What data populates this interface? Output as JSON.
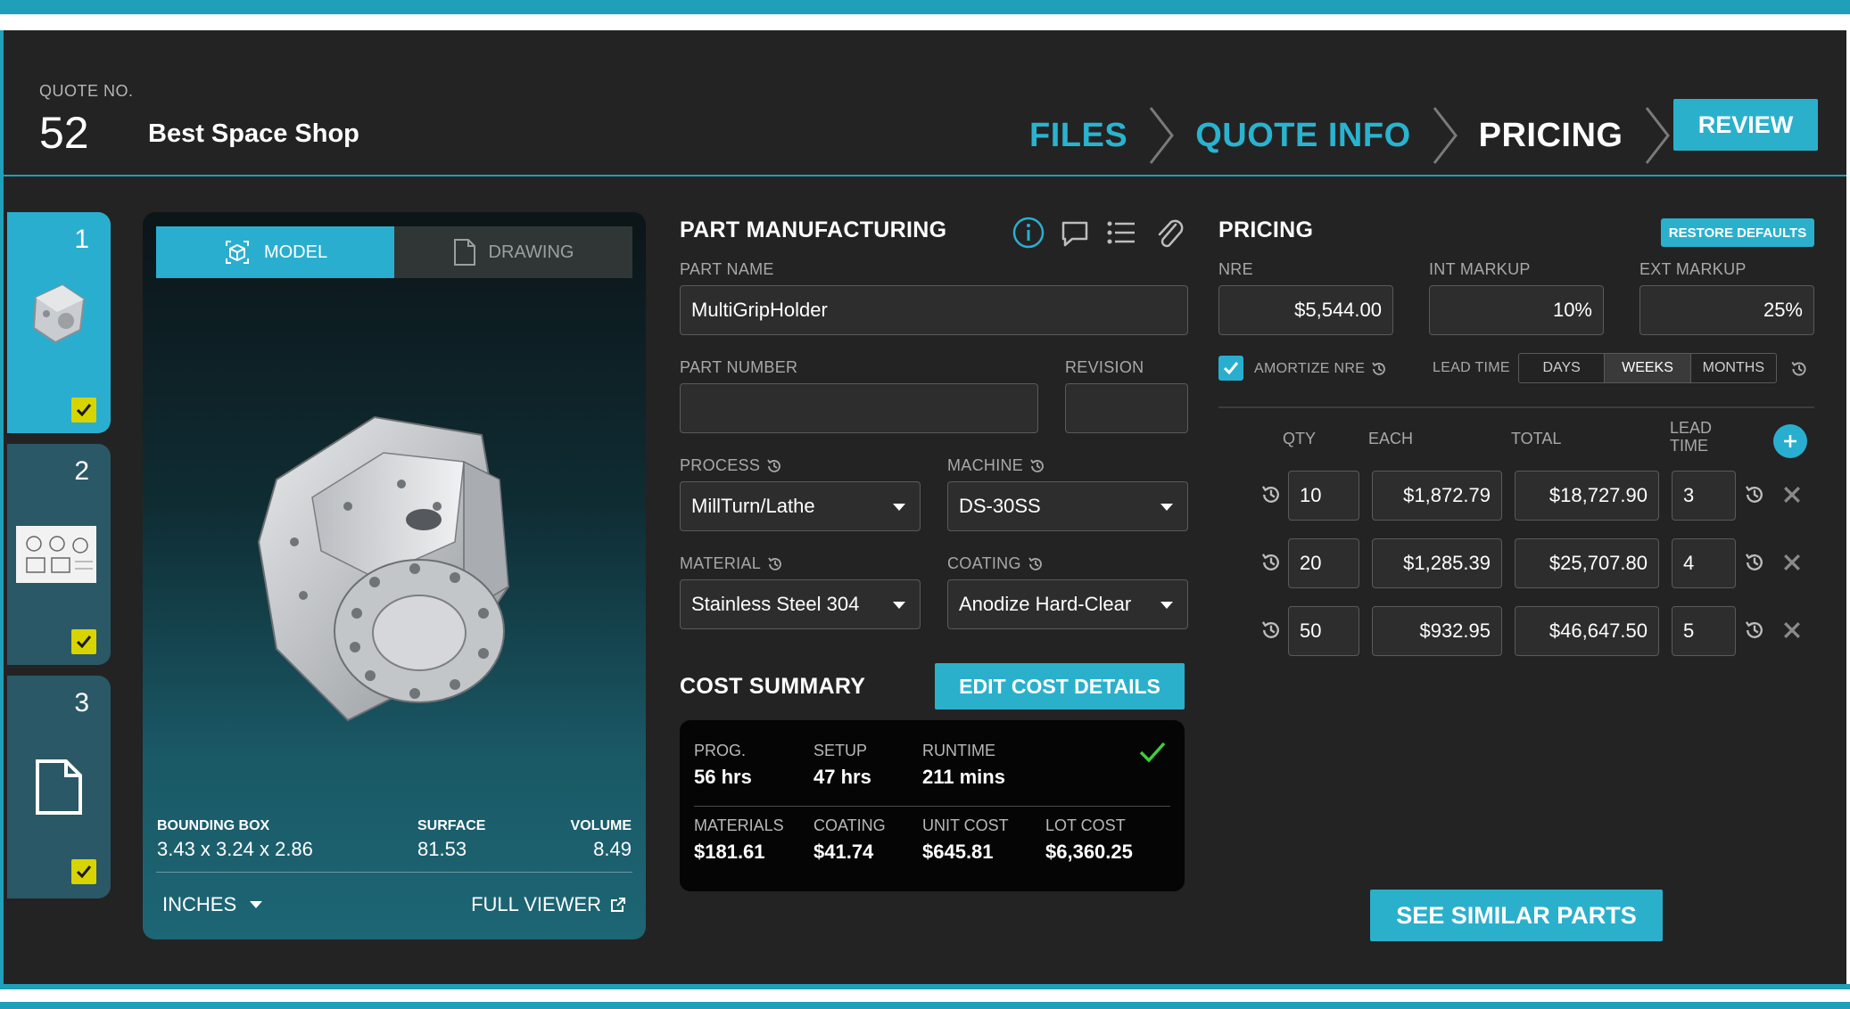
{
  "header": {
    "quote_label": "QUOTE NO.",
    "quote_number": "52",
    "shop_name": "Best Space Shop",
    "steps": [
      "FILES",
      "QUOTE INFO",
      "PRICING"
    ],
    "review_label": "REVIEW"
  },
  "parts": [
    {
      "number": "1",
      "selected": true
    },
    {
      "number": "2",
      "selected": false
    },
    {
      "number": "3",
      "selected": false
    }
  ],
  "viewer": {
    "tab_model": "MODEL",
    "tab_drawing": "DRAWING",
    "bounding_box_label": "BOUNDING BOX",
    "bounding_box_value": "3.43 x 3.24 x 2.86",
    "surface_label": "SURFACE",
    "surface_value": "81.53",
    "volume_label": "VOLUME",
    "volume_value": "8.49",
    "units": "INCHES",
    "full_viewer": "FULL VIEWER"
  },
  "manufacturing": {
    "title": "PART MANUFACTURING",
    "part_name_label": "PART NAME",
    "part_name_value": "MultiGripHolder",
    "part_number_label": "PART NUMBER",
    "part_number_value": "",
    "revision_label": "REVISION",
    "revision_value": "",
    "process_label": "PROCESS",
    "process_value": "MillTurn/Lathe",
    "machine_label": "MACHINE",
    "machine_value": "DS-30SS",
    "material_label": "MATERIAL",
    "material_value": "Stainless Steel 304",
    "coating_label": "COATING",
    "coating_value": "Anodize Hard-Clear"
  },
  "cost_summary": {
    "title": "COST SUMMARY",
    "edit_label": "EDIT COST DETAILS",
    "prog_label": "PROG.",
    "prog_value": "56 hrs",
    "setup_label": "SETUP",
    "setup_value": "47 hrs",
    "runtime_label": "RUNTIME",
    "runtime_value": "211 mins",
    "materials_label": "MATERIALS",
    "materials_value": "$181.61",
    "coating_label": "COATING",
    "coating_value": "$41.74",
    "unit_cost_label": "UNIT COST",
    "unit_cost_value": "$645.81",
    "lot_cost_label": "LOT COST",
    "lot_cost_value": "$6,360.25"
  },
  "pricing": {
    "title": "PRICING",
    "restore_label": "RESTORE DEFAULTS",
    "nre_label": "NRE",
    "nre_value": "$5,544.00",
    "int_markup_label": "INT MARKUP",
    "int_markup_value": "10%",
    "ext_markup_label": "EXT MARKUP",
    "ext_markup_value": "25%",
    "amortize_label": "AMORTIZE NRE",
    "lead_time_label": "LEAD TIME",
    "lead_units": [
      "DAYS",
      "WEEKS",
      "MONTHS"
    ],
    "lead_unit_selected": "WEEKS",
    "col_qty": "QTY",
    "col_each": "EACH",
    "col_total": "TOTAL",
    "col_lead_1": "LEAD",
    "col_lead_2": "TIME",
    "rows": [
      {
        "qty": "10",
        "each": "$1,872.79",
        "total": "$18,727.90",
        "lead": "3"
      },
      {
        "qty": "20",
        "each": "$1,285.39",
        "total": "$25,707.80",
        "lead": "4"
      },
      {
        "qty": "50",
        "each": "$932.95",
        "total": "$46,647.50",
        "lead": "5"
      }
    ],
    "similar_label": "SEE SIMILAR PARTS"
  },
  "colors": {
    "accent": "#2bb0cc",
    "background": "#232323",
    "check_yellow": "#d8d400",
    "ok_green": "#3ccf3c"
  }
}
